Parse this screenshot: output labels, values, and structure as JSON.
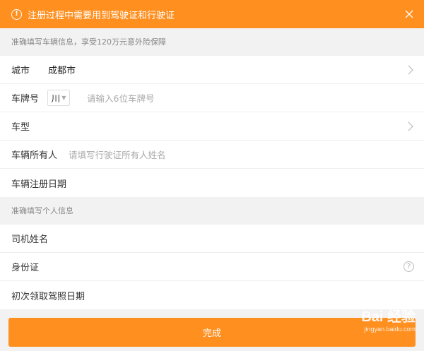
{
  "notice": {
    "text": "注册过程中需要用到驾驶证和行驶证",
    "warn_glyph": "!"
  },
  "sections": {
    "vehicle_header": "准确填写车辆信息，享受120万元意外险保障",
    "personal_header": "准确填写个人信息"
  },
  "vehicle": {
    "city_label": "城市",
    "city_value": "成都市",
    "plate_label": "车牌号",
    "plate_prefix": "川",
    "plate_placeholder": "请输入6位车牌号",
    "model_label": "车型",
    "owner_label": "车辆所有人",
    "owner_placeholder": "请填写行驶证所有人姓名",
    "register_date_label": "车辆注册日期"
  },
  "personal": {
    "driver_name_label": "司机姓名",
    "id_label": "身份证",
    "help_glyph": "?",
    "license_date_label": "初次领取驾照日期"
  },
  "submit_label": "完成",
  "watermark": {
    "logo": "Bai 经验",
    "url": "jingyan.baidu.com"
  },
  "colors": {
    "accent": "#ff8f1f",
    "background": "#f2f2f2"
  }
}
